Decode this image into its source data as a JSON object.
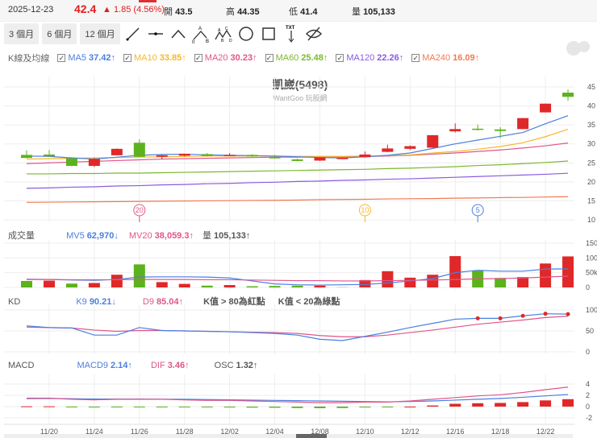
{
  "header": {
    "date": "2025-12-23",
    "price": "42.4",
    "change": "▲ 1.85 (4.56%)",
    "open_label": "開",
    "open": "43.5",
    "high_label": "高",
    "high": "44.35",
    "low_label": "低",
    "low": "41.4",
    "vol_label": "量",
    "vol": "105,133"
  },
  "toolbar": {
    "ranges": [
      "3 個月",
      "6 個月",
      "12 個月"
    ],
    "tools": [
      "line-tool",
      "horizontal-line-tool",
      "angle-tool",
      "abc-pattern-tool",
      "abcd-pattern-tool",
      "circle-tool",
      "rectangle-tool",
      "text-tool",
      "hide-drawings-tool"
    ],
    "txt": "TXT"
  },
  "ma_legend": {
    "label": "K線及均線",
    "items": [
      {
        "name": "MA5",
        "value": "37.42↑",
        "color": "#4a7fe0"
      },
      {
        "name": "MA10",
        "value": "33.85↑",
        "color": "#f5b82e"
      },
      {
        "name": "MA20",
        "value": "30.23↑",
        "color": "#e0558a"
      },
      {
        "name": "MA60",
        "value": "25.48↑",
        "color": "#7cb82f"
      },
      {
        "name": "MA120",
        "value": "22.26↑",
        "color": "#8a5ce0"
      },
      {
        "name": "MA240",
        "value": "16.09↑",
        "color": "#f07a50"
      }
    ]
  },
  "watermark": "玩股網",
  "main": {
    "title": "凱崴(5498)",
    "subtitle": "WantGoo 玩股網",
    "yticks": [
      45,
      40,
      35,
      30,
      25,
      20,
      15,
      10
    ],
    "markers": [
      {
        "label": "20",
        "index": 5,
        "color": "#e0558a"
      },
      {
        "label": "10",
        "index": 15,
        "color": "#f5b82e"
      },
      {
        "label": "5",
        "index": 20,
        "color": "#4a7fe0"
      }
    ]
  },
  "volume": {
    "title": "成交量",
    "mv5_label": "MV5",
    "mv5": "62,970↓",
    "mv20_label": "MV20",
    "mv20": "38,059.3↑",
    "vol_label": "量",
    "vol": "105,133↑",
    "yticks": [
      "150k",
      "100k",
      "50k",
      "0"
    ]
  },
  "kd": {
    "title": "KD",
    "k_label": "K9",
    "k": "90.21↓",
    "d_label": "D9",
    "d": "85.04↑",
    "note1": "K值 > 80為紅點",
    "note2": "K值 < 20為綠點",
    "yticks": [
      100,
      50,
      0
    ]
  },
  "macd": {
    "title": "MACD",
    "macd9_label": "MACD9",
    "macd9": "2.14↑",
    "dif_label": "DIF",
    "dif": "3.46↑",
    "osc_label": "OSC",
    "osc": "1.32↑",
    "yticks": [
      4,
      2,
      0,
      -2
    ]
  },
  "xlabels": [
    "11/20",
    "11/24",
    "11/26",
    "11/28",
    "12/02",
    "12/04",
    "12/08",
    "12/10",
    "12/12",
    "12/16",
    "12/18",
    "12/22"
  ],
  "colors": {
    "up": "#e02828",
    "down": "#5cb21c",
    "grid": "#eeeeee"
  },
  "chart_data": {
    "type": "candlestick",
    "ohlc": [
      [
        27.1,
        28.3,
        26.2,
        26.3
      ],
      [
        27.2,
        28.4,
        26.6,
        26.7
      ],
      [
        26.2,
        26.5,
        24.1,
        24.2
      ],
      [
        24.2,
        26.4,
        23.9,
        26.0
      ],
      [
        27.0,
        28.8,
        27.0,
        28.7
      ],
      [
        30.3,
        31.2,
        26.5,
        26.6
      ],
      [
        26.6,
        27.2,
        25.9,
        27.0
      ],
      [
        26.9,
        27.4,
        26.7,
        27.4
      ],
      [
        27.3,
        27.6,
        26.7,
        26.8
      ],
      [
        26.9,
        27.6,
        26.8,
        27.1
      ],
      [
        27.1,
        27.3,
        26.6,
        26.7
      ],
      [
        26.5,
        27.1,
        26.1,
        26.2
      ],
      [
        25.9,
        26.1,
        25.4,
        25.5
      ],
      [
        25.6,
        26.5,
        25.5,
        26.4
      ],
      [
        26.2,
        26.4,
        26.1,
        26.3
      ],
      [
        26.5,
        28.0,
        26.4,
        27.2
      ],
      [
        27.9,
        29.8,
        27.8,
        28.8
      ],
      [
        28.7,
        29.6,
        28.4,
        29.4
      ],
      [
        29.0,
        32.3,
        29.0,
        32.3
      ],
      [
        33.3,
        35.4,
        33.0,
        33.9
      ],
      [
        34.0,
        35.1,
        33.5,
        33.7
      ],
      [
        33.8,
        34.4,
        31.5,
        33.4
      ],
      [
        33.9,
        36.8,
        33.9,
        36.8
      ],
      [
        38.3,
        40.6,
        38.3,
        40.6
      ],
      [
        43.5,
        44.35,
        41.4,
        42.4
      ]
    ],
    "ma5": [
      26.8,
      26.7,
      26.3,
      26.0,
      26.5,
      27.0,
      27.2,
      27.3,
      27.1,
      27.0,
      26.9,
      26.8,
      26.6,
      26.4,
      26.3,
      26.6,
      27.0,
      27.6,
      28.8,
      30.0,
      31.0,
      32.0,
      33.0,
      35.3,
      37.42
    ],
    "ma10": [
      26.0,
      26.1,
      26.2,
      26.3,
      26.4,
      26.5,
      26.6,
      26.7,
      26.8,
      26.8,
      26.8,
      26.8,
      26.7,
      26.7,
      26.7,
      26.8,
      26.9,
      27.1,
      27.6,
      28.0,
      28.6,
      29.3,
      30.3,
      31.9,
      33.85
    ],
    "ma20": [
      24.8,
      25.0,
      25.2,
      25.4,
      25.6,
      25.8,
      26.0,
      26.1,
      26.2,
      26.3,
      26.4,
      26.5,
      26.5,
      26.6,
      26.6,
      26.7,
      26.8,
      27.0,
      27.3,
      27.6,
      28.0,
      28.4,
      28.9,
      29.5,
      30.23
    ],
    "ma60": [
      22.1,
      22.1,
      22.2,
      22.2,
      22.3,
      22.3,
      22.4,
      22.5,
      22.6,
      22.7,
      22.8,
      22.9,
      23.0,
      23.1,
      23.2,
      23.3,
      23.5,
      23.6,
      23.8,
      24.0,
      24.3,
      24.5,
      24.8,
      25.1,
      25.48
    ],
    "ma120": [
      18.3,
      18.4,
      18.6,
      18.7,
      18.9,
      19.0,
      19.2,
      19.3,
      19.5,
      19.6,
      19.8,
      19.9,
      20.1,
      20.2,
      20.4,
      20.5,
      20.7,
      20.8,
      21.0,
      21.2,
      21.4,
      21.6,
      21.8,
      22.0,
      22.26
    ],
    "ma240": [
      14.6,
      14.65,
      14.7,
      14.75,
      14.8,
      14.85,
      14.9,
      14.95,
      15.0,
      15.05,
      15.1,
      15.15,
      15.2,
      15.3,
      15.35,
      15.4,
      15.5,
      15.55,
      15.6,
      15.7,
      15.75,
      15.85,
      15.9,
      16.0,
      16.09
    ],
    "volume_k": [
      22,
      23,
      13,
      15,
      43,
      78,
      18,
      12,
      6,
      8,
      4,
      5,
      6,
      6,
      2,
      25,
      55,
      33,
      43,
      106,
      56,
      32,
      35,
      81,
      105
    ],
    "volume_up": [
      0,
      1,
      0,
      1,
      1,
      0,
      1,
      1,
      0,
      1,
      0,
      0,
      0,
      1,
      2,
      1,
      1,
      1,
      1,
      1,
      0,
      0,
      1,
      1,
      1
    ],
    "mv5_k": [
      28,
      27,
      25,
      24,
      27,
      35,
      36,
      36,
      35,
      32,
      22,
      12,
      9,
      8,
      9,
      10,
      15,
      22,
      30,
      50,
      58,
      55,
      55,
      62,
      62.97
    ],
    "mv20_k": [
      27,
      27,
      26,
      26,
      26,
      27,
      27,
      27,
      26,
      26,
      25,
      24,
      23,
      23,
      22,
      22,
      23,
      24,
      25,
      27,
      29,
      30,
      32,
      35,
      38.06
    ],
    "k9": [
      62,
      58,
      57,
      40,
      40,
      58,
      51,
      50,
      49,
      48,
      46,
      44,
      40,
      30,
      27,
      37,
      47,
      58,
      68,
      78,
      80,
      80,
      86,
      91,
      90.21
    ],
    "d9": [
      59,
      58,
      57,
      52,
      49,
      51,
      51,
      50,
      49,
      48,
      47,
      46,
      44,
      39,
      36,
      36,
      40,
      46,
      52,
      59,
      66,
      71,
      76,
      82,
      85.04
    ],
    "dif": [
      1.5,
      1.5,
      1.3,
      1.2,
      1.3,
      1.3,
      1.3,
      1.2,
      1.1,
      1.1,
      1.0,
      0.9,
      0.8,
      0.7,
      0.7,
      0.8,
      0.8,
      1.0,
      1.3,
      1.6,
      1.9,
      2.1,
      2.5,
      3.0,
      3.46
    ],
    "macd9": [
      1.4,
      1.45,
      1.4,
      1.35,
      1.35,
      1.35,
      1.3,
      1.3,
      1.25,
      1.2,
      1.15,
      1.1,
      1.05,
      1.0,
      0.95,
      0.9,
      0.85,
      0.9,
      1.0,
      1.15,
      1.3,
      1.45,
      1.65,
      1.9,
      2.14
    ],
    "osc": [
      0.05,
      0.05,
      -0.1,
      -0.15,
      -0.1,
      -0.1,
      -0.1,
      -0.1,
      -0.12,
      -0.15,
      -0.18,
      -0.2,
      -0.25,
      -0.28,
      -0.25,
      -0.15,
      -0.03,
      0,
      0.2,
      0.5,
      0.6,
      0.65,
      0.8,
      1.1,
      1.32
    ],
    "price_range": [
      10,
      45
    ],
    "volume_range_k": [
      0,
      150
    ],
    "kd_range": [
      0,
      100
    ],
    "macd_range": [
      -2,
      4
    ]
  }
}
